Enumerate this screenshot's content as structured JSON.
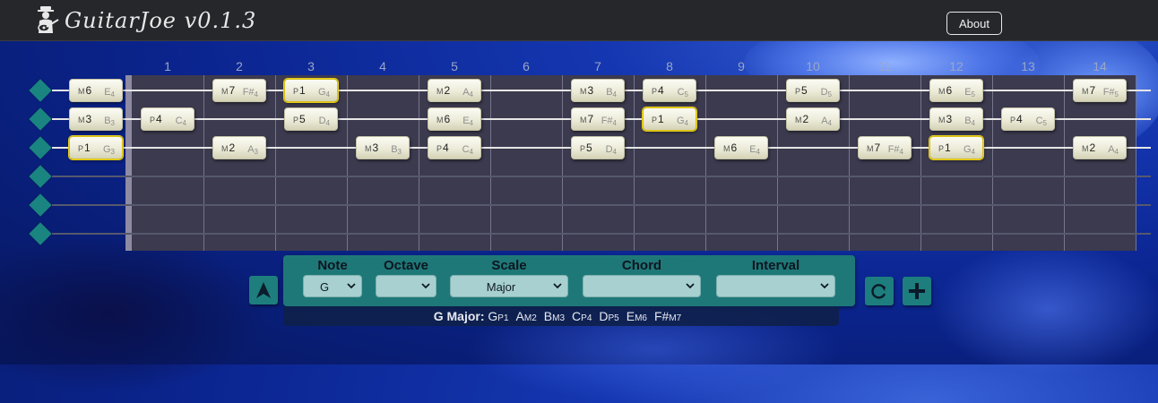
{
  "app": {
    "title": "GuitarJoe v0.1.3",
    "about_label": "About"
  },
  "fret_numbers": [
    "1",
    "2",
    "3",
    "4",
    "5",
    "6",
    "7",
    "8",
    "9",
    "10",
    "11",
    "12",
    "13",
    "14"
  ],
  "strings": {
    "count": 6,
    "active": [
      1,
      2,
      3
    ]
  },
  "notes": [
    {
      "string": 1,
      "fret": 0,
      "interval_q": "M",
      "interval_n": "6",
      "note": "E",
      "octave": "4",
      "root": false
    },
    {
      "string": 1,
      "fret": 2,
      "interval_q": "M",
      "interval_n": "7",
      "note": "F#",
      "octave": "4",
      "root": false
    },
    {
      "string": 1,
      "fret": 3,
      "interval_q": "P",
      "interval_n": "1",
      "note": "G",
      "octave": "4",
      "root": true
    },
    {
      "string": 1,
      "fret": 5,
      "interval_q": "M",
      "interval_n": "2",
      "note": "A",
      "octave": "4",
      "root": false
    },
    {
      "string": 1,
      "fret": 7,
      "interval_q": "M",
      "interval_n": "3",
      "note": "B",
      "octave": "4",
      "root": false
    },
    {
      "string": 1,
      "fret": 8,
      "interval_q": "P",
      "interval_n": "4",
      "note": "C",
      "octave": "5",
      "root": false
    },
    {
      "string": 1,
      "fret": 10,
      "interval_q": "P",
      "interval_n": "5",
      "note": "D",
      "octave": "5",
      "root": false
    },
    {
      "string": 1,
      "fret": 12,
      "interval_q": "M",
      "interval_n": "6",
      "note": "E",
      "octave": "5",
      "root": false
    },
    {
      "string": 1,
      "fret": 14,
      "interval_q": "M",
      "interval_n": "7",
      "note": "F#",
      "octave": "5",
      "root": false
    },
    {
      "string": 2,
      "fret": 0,
      "interval_q": "M",
      "interval_n": "3",
      "note": "B",
      "octave": "3",
      "root": false
    },
    {
      "string": 2,
      "fret": 1,
      "interval_q": "P",
      "interval_n": "4",
      "note": "C",
      "octave": "4",
      "root": false
    },
    {
      "string": 2,
      "fret": 3,
      "interval_q": "P",
      "interval_n": "5",
      "note": "D",
      "octave": "4",
      "root": false
    },
    {
      "string": 2,
      "fret": 5,
      "interval_q": "M",
      "interval_n": "6",
      "note": "E",
      "octave": "4",
      "root": false
    },
    {
      "string": 2,
      "fret": 7,
      "interval_q": "M",
      "interval_n": "7",
      "note": "F#",
      "octave": "4",
      "root": false
    },
    {
      "string": 2,
      "fret": 8,
      "interval_q": "P",
      "interval_n": "1",
      "note": "G",
      "octave": "4",
      "root": true
    },
    {
      "string": 2,
      "fret": 10,
      "interval_q": "M",
      "interval_n": "2",
      "note": "A",
      "octave": "4",
      "root": false
    },
    {
      "string": 2,
      "fret": 12,
      "interval_q": "M",
      "interval_n": "3",
      "note": "B",
      "octave": "4",
      "root": false
    },
    {
      "string": 2,
      "fret": 13,
      "interval_q": "P",
      "interval_n": "4",
      "note": "C",
      "octave": "5",
      "root": false
    },
    {
      "string": 3,
      "fret": 0,
      "interval_q": "P",
      "interval_n": "1",
      "note": "G",
      "octave": "3",
      "root": true
    },
    {
      "string": 3,
      "fret": 2,
      "interval_q": "M",
      "interval_n": "2",
      "note": "A",
      "octave": "3",
      "root": false
    },
    {
      "string": 3,
      "fret": 4,
      "interval_q": "M",
      "interval_n": "3",
      "note": "B",
      "octave": "3",
      "root": false
    },
    {
      "string": 3,
      "fret": 5,
      "interval_q": "P",
      "interval_n": "4",
      "note": "C",
      "octave": "4",
      "root": false
    },
    {
      "string": 3,
      "fret": 7,
      "interval_q": "P",
      "interval_n": "5",
      "note": "D",
      "octave": "4",
      "root": false
    },
    {
      "string": 3,
      "fret": 9,
      "interval_q": "M",
      "interval_n": "6",
      "note": "E",
      "octave": "4",
      "root": false
    },
    {
      "string": 3,
      "fret": 11,
      "interval_q": "M",
      "interval_n": "7",
      "note": "F#",
      "octave": "4",
      "root": false
    },
    {
      "string": 3,
      "fret": 12,
      "interval_q": "P",
      "interval_n": "1",
      "note": "G",
      "octave": "4",
      "root": true
    },
    {
      "string": 3,
      "fret": 14,
      "interval_q": "M",
      "interval_n": "2",
      "note": "A",
      "octave": "4",
      "root": false
    }
  ],
  "controls": {
    "note": {
      "label": "Note",
      "value": "G"
    },
    "octave": {
      "label": "Octave",
      "value": ""
    },
    "scale": {
      "label": "Scale",
      "value": "Major"
    },
    "chord": {
      "label": "Chord",
      "value": ""
    },
    "interval": {
      "label": "Interval",
      "value": ""
    }
  },
  "scale_summary": {
    "name": "G Major:",
    "degrees": [
      {
        "note": "G",
        "degree": "P1"
      },
      {
        "note": "A",
        "degree": "M2"
      },
      {
        "note": "B",
        "degree": "M3"
      },
      {
        "note": "C",
        "degree": "P4"
      },
      {
        "note": "D",
        "degree": "P5"
      },
      {
        "note": "E",
        "degree": "M6"
      },
      {
        "note": "F#",
        "degree": "M7"
      }
    ]
  },
  "icons": {
    "brand": "guitar-player-icon",
    "arrow": "navigation-arrow-icon",
    "refresh": "refresh-icon",
    "add": "plus-icon",
    "selector": "diamond-icon"
  },
  "colors": {
    "navbar": "#25272b",
    "fretboard": "#3c3a4e",
    "teal": "#1f7878",
    "root_outline": "#e8cf1c"
  }
}
